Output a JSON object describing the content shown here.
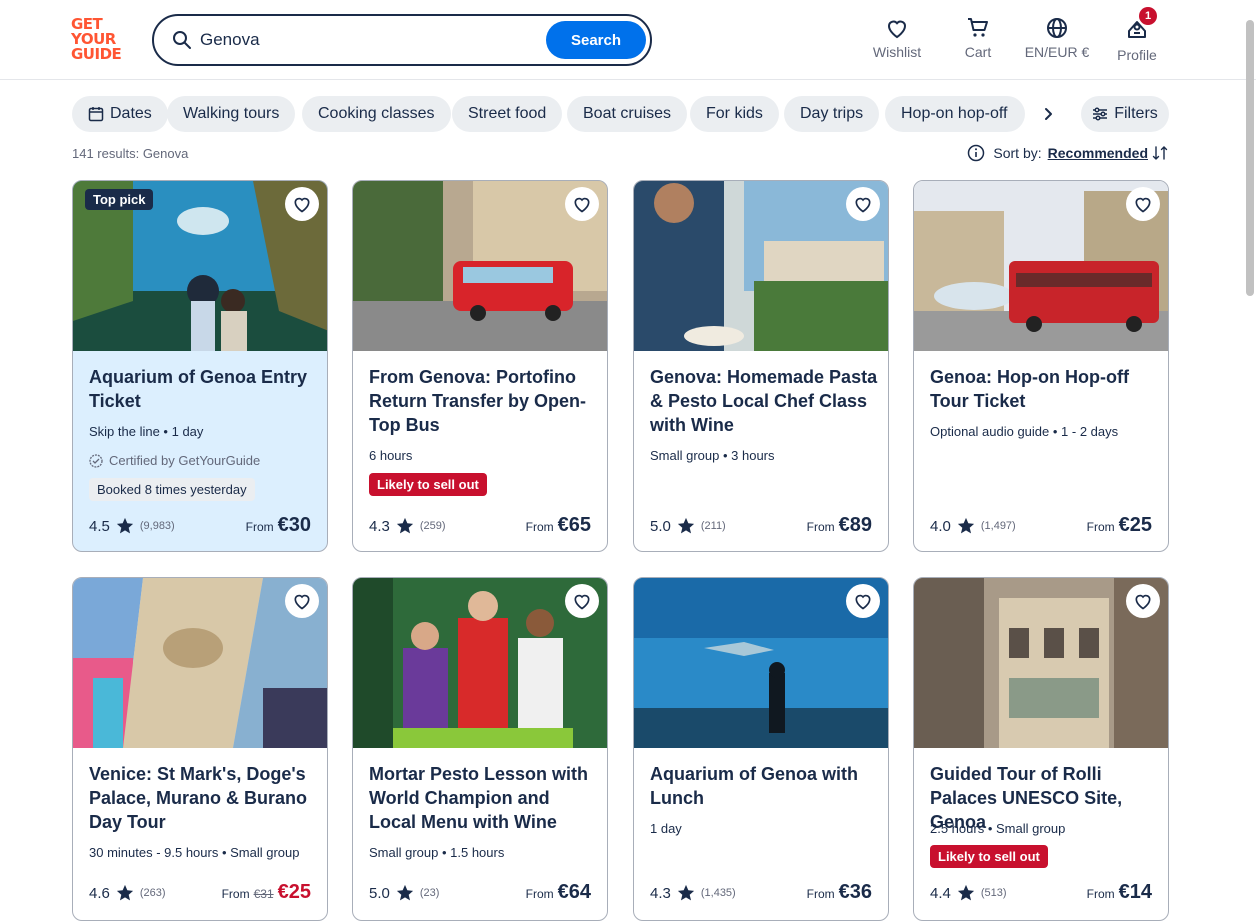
{
  "header": {
    "logo_lines": [
      "GET",
      "YOUR",
      "GUIDE"
    ],
    "search": {
      "value": "Genova",
      "button_label": "Search"
    },
    "nav": {
      "wishlist": "Wishlist",
      "cart": "Cart",
      "language": "EN/EUR €",
      "profile": "Profile",
      "profile_badge": "1"
    }
  },
  "chips": [
    "Dates",
    "Walking tours",
    "Cooking classes",
    "Street food",
    "Boat cruises",
    "For kids",
    "Day trips",
    "Hop-on hop-off"
  ],
  "filters_label": "Filters",
  "results_text": "141 results: Genova",
  "sort": {
    "label": "Sort by:",
    "value": "Recommended"
  },
  "cards": [
    {
      "title": "Aquarium of Genoa Entry Ticket",
      "meta": "Skip the line • 1 day",
      "tag": "Top pick",
      "certified": "Certified by GetYourGuide",
      "booked": "Booked 8 times yesterday",
      "rating": "4.5",
      "reviews": "(9,983)",
      "from": "From",
      "price": "€30"
    },
    {
      "title": "From Genova: Portofino Return Transfer by Open-Top Bus",
      "meta": "6 hours",
      "sellout": "Likely to sell out",
      "rating": "4.3",
      "reviews": "(259)",
      "from": "From",
      "price": "€65"
    },
    {
      "title": "Genova: Homemade Pasta & Pesto Local Chef Class with Wine",
      "meta": "Small group • 3 hours",
      "rating": "5.0",
      "reviews": "(211)",
      "from": "From",
      "price": "€89"
    },
    {
      "title": "Genoa: Hop-on Hop-off Tour Ticket",
      "meta": "Optional audio guide • 1 - 2 days",
      "rating": "4.0",
      "reviews": "(1,497)",
      "from": "From",
      "price": "€25"
    },
    {
      "title": "Venice: St Mark's, Doge's Palace, Murano & Burano Day Tour",
      "meta": "30 minutes - 9.5 hours • Small group",
      "rating": "4.6",
      "reviews": "(263)",
      "from": "From",
      "old_price": "€31",
      "price": "€25"
    },
    {
      "title": "Mortar Pesto Lesson with World Champion and Local Menu with Wine",
      "meta": "Small group • 1.5 hours",
      "rating": "5.0",
      "reviews": "(23)",
      "from": "From",
      "price": "€64"
    },
    {
      "title": "Aquarium of Genoa with Lunch",
      "meta": "1 day",
      "rating": "4.3",
      "reviews": "(1,435)",
      "from": "From",
      "price": "€36"
    },
    {
      "title": "Guided Tour of Rolli Palaces UNESCO Site, Genoa",
      "meta": "2.5 hours • Small group",
      "sellout": "Likely to sell out",
      "rating": "4.4",
      "reviews": "(513)",
      "from": "From",
      "price": "€14"
    }
  ],
  "colors": {
    "brand": "#ff5533",
    "accent": "#0071eb",
    "navy": "#1a2b49",
    "sale": "#c8102e",
    "highlight": "#dceffe"
  }
}
